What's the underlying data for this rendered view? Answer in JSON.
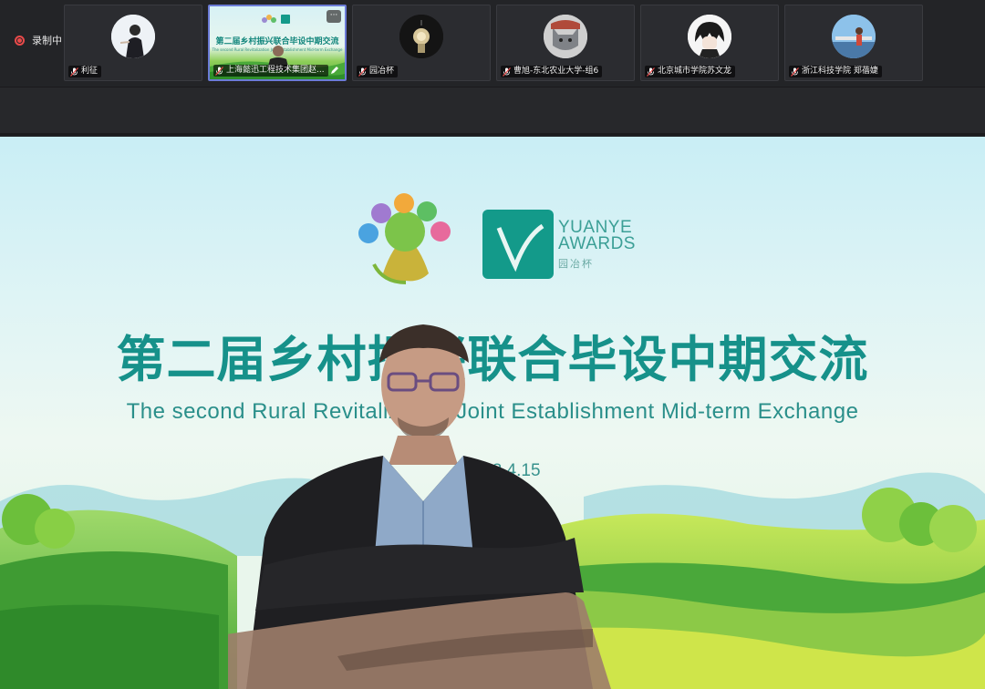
{
  "recording": {
    "label": "录制中"
  },
  "participants": [
    {
      "name": "利征",
      "active": false
    },
    {
      "name": "上海懿迅工程技术集团赵...",
      "active": true
    },
    {
      "name": "园冶杯",
      "active": false
    },
    {
      "name": "曹旭-东北农业大学-组6",
      "active": false
    },
    {
      "name": "北京城市学院苏文龙",
      "active": false
    },
    {
      "name": "浙江科技学院 郑蓓婕",
      "active": false
    }
  ],
  "thumbnail": {
    "menu_glyph": "···"
  },
  "slide": {
    "title": "第二届乡村振兴联合毕设中期交流",
    "subtitle": "The second Rural Revitalization Joint Establishment Mid-term Exchange",
    "date": "2023.4.15",
    "brand": {
      "line1": "YUANYE",
      "line2": "AWARDS",
      "cn": "园冶杯"
    }
  },
  "colors": {
    "accent": "#16918a",
    "record": "#e84a4a",
    "active_border": "#6b7bd6"
  }
}
